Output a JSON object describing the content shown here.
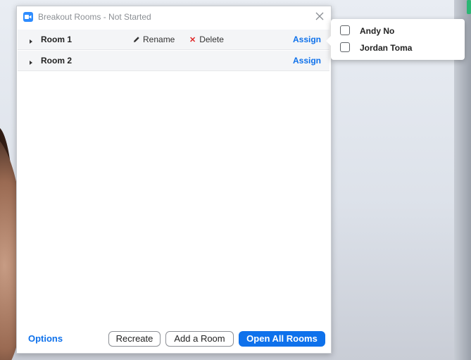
{
  "window": {
    "title": "Breakout Rooms - Not Started",
    "accent_color": "#0e71eb",
    "icon": "zoom-camera-icon"
  },
  "rooms": [
    {
      "name": "Room 1",
      "rename_label": "Rename",
      "delete_label": "Delete",
      "assign_label": "Assign"
    },
    {
      "name": "Room 2",
      "assign_label": "Assign"
    }
  ],
  "footer": {
    "options_label": "Options",
    "recreate_label": "Recreate",
    "add_room_label": "Add a Room",
    "open_all_label": "Open All Rooms"
  },
  "assign_popup": {
    "participants": [
      {
        "name": "Andy No",
        "checked": false
      },
      {
        "name": "Jordan Toma",
        "checked": false
      }
    ]
  }
}
